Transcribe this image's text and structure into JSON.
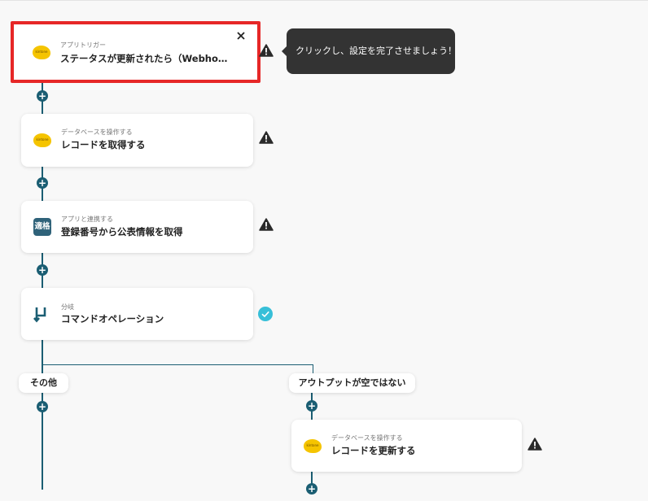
{
  "tooltip": {
    "text": "クリックし、設定を完了させましょう！"
  },
  "steps": [
    {
      "subtitle": "アプリトリガー",
      "title": "ステータスが更新されたら（Webho…",
      "icon": "kintone-logo-icon",
      "status": "warning",
      "selected": true
    },
    {
      "subtitle": "データベースを操作する",
      "title": "レコードを取得する",
      "icon": "kintone-logo-icon",
      "status": "warning"
    },
    {
      "subtitle": "アプリと連携する",
      "title": "登録番号から公表情報を取得",
      "icon": "invoice-registry-icon",
      "icon_text": "適格",
      "status": "warning"
    },
    {
      "subtitle": "分岐",
      "title": "コマンドオペレーション",
      "icon": "branch-icon",
      "status": "complete"
    },
    {
      "subtitle": "データベースを操作する",
      "title": "レコードを更新する",
      "icon": "kintone-logo-icon",
      "status": "warning"
    }
  ],
  "branches": {
    "left": "その他",
    "right": "アウトプットが空ではない"
  },
  "colors": {
    "line": "#1b5e73",
    "highlight": "#e62727",
    "check": "#37bfd8",
    "tooltip_bg": "#333333"
  }
}
